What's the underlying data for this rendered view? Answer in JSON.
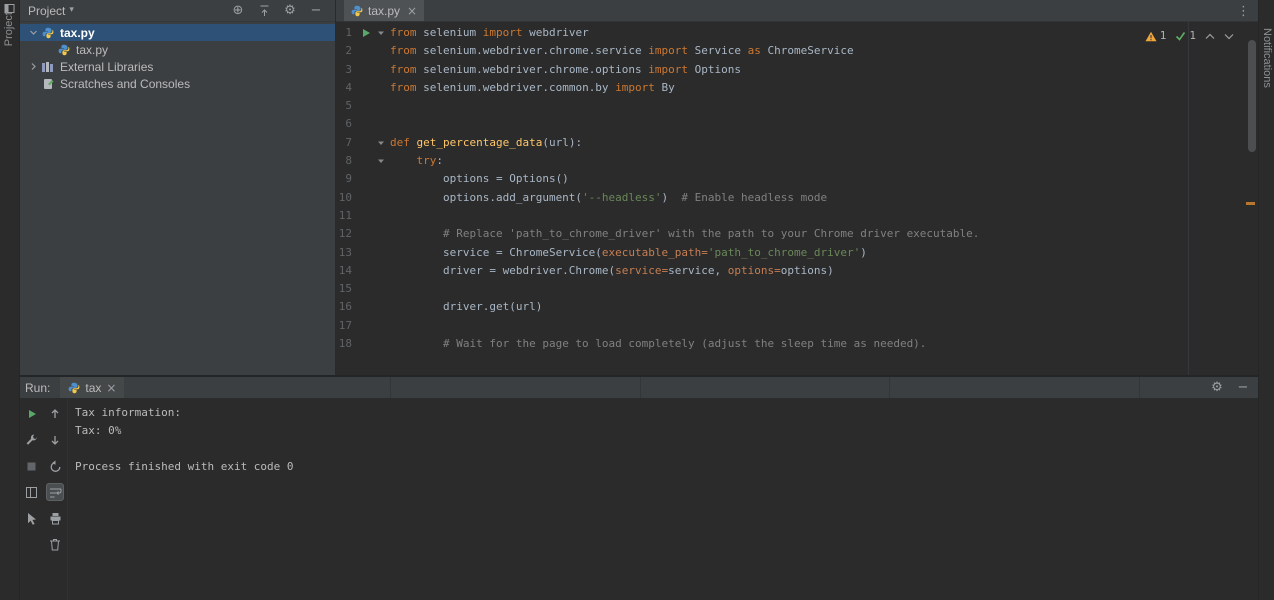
{
  "stripes": {
    "left_label": "Project",
    "right_label": "Notifications"
  },
  "glyphs": {
    "locate": "⊕",
    "gear": "⚙",
    "minus": "−",
    "dots": "⋮",
    "close": "×",
    "dropdown": "▾"
  },
  "colors": {
    "keyword": "#cc7832",
    "string": "#6a8759",
    "comment": "#808080",
    "function_name": "#ffc66b",
    "named_argument": "#c57e53",
    "selection": "#2d5177",
    "run_green": "#59a869",
    "warning": "#f0a63a",
    "ok_green": "#5fad65",
    "panel": "#3c3f41",
    "editor_bg": "#2b2b2b"
  },
  "project_panel": {
    "title": "Project",
    "header_icons": [
      {
        "name": "locate-file-icon",
        "icon": "locate"
      },
      {
        "name": "collapse-all-icon",
        "icon": "collapse"
      },
      {
        "name": "settings-gear-icon",
        "icon": "gear"
      },
      {
        "name": "hide-panel-icon",
        "icon": "minus"
      }
    ],
    "tree": [
      {
        "label": "tax.py",
        "icon": "python-file",
        "level": 0,
        "chevron": "down",
        "selected": true,
        "bold": true
      },
      {
        "label": "tax.py",
        "icon": "python-file",
        "level": 1
      },
      {
        "label": "External Libraries",
        "icon": "libraries",
        "level": 0,
        "chevron": "right"
      },
      {
        "label": "Scratches and Consoles",
        "icon": "scratches",
        "level": 0
      }
    ]
  },
  "editor": {
    "tab": {
      "label": "tax.py"
    },
    "inspections": {
      "warning_count": "1",
      "ok_count": "1"
    },
    "code": [
      {
        "n": "1",
        "run": true,
        "fold": true,
        "tokens": [
          [
            "from ",
            "kw"
          ],
          [
            "selenium ",
            "pl"
          ],
          [
            "import ",
            "kw"
          ],
          [
            "webdriver",
            "pl"
          ]
        ]
      },
      {
        "n": "2",
        "tokens": [
          [
            "from ",
            "kw"
          ],
          [
            "selenium.webdriver.chrome.service ",
            "pl"
          ],
          [
            "import ",
            "kw"
          ],
          [
            "Service ",
            "pl"
          ],
          [
            "as ",
            "kw"
          ],
          [
            "ChromeService",
            "pl"
          ]
        ]
      },
      {
        "n": "3",
        "tokens": [
          [
            "from ",
            "kw"
          ],
          [
            "selenium.webdriver.chrome.options ",
            "pl"
          ],
          [
            "import ",
            "kw"
          ],
          [
            "Options",
            "pl"
          ]
        ]
      },
      {
        "n": "4",
        "tokens": [
          [
            "from ",
            "kw"
          ],
          [
            "selenium.webdriver.common.by ",
            "pl"
          ],
          [
            "import ",
            "kw"
          ],
          [
            "By",
            "pl"
          ]
        ]
      },
      {
        "n": "5",
        "tokens": []
      },
      {
        "n": "6",
        "tokens": []
      },
      {
        "n": "7",
        "fold": true,
        "tokens": [
          [
            "def ",
            "kw"
          ],
          [
            "get_percentage_data",
            "fn"
          ],
          [
            "(url):",
            "pl"
          ]
        ]
      },
      {
        "n": "8",
        "fold": true,
        "tokens": [
          [
            "    ",
            "pl"
          ],
          [
            "try",
            "kw"
          ],
          [
            ":",
            "pl"
          ]
        ]
      },
      {
        "n": "9",
        "tokens": [
          [
            "        options = Options()",
            "pl"
          ]
        ]
      },
      {
        "n": "10",
        "tokens": [
          [
            "        options.add_argument(",
            "pl"
          ],
          [
            "'--headless'",
            "st"
          ],
          [
            ")  ",
            "pl"
          ],
          [
            "# Enable headless mode",
            "cm"
          ]
        ]
      },
      {
        "n": "11",
        "tokens": []
      },
      {
        "n": "12",
        "tokens": [
          [
            "        ",
            "pl"
          ],
          [
            "# Replace 'path_to_chrome_driver' with the path to your Chrome driver executable.",
            "cm"
          ]
        ]
      },
      {
        "n": "13",
        "tokens": [
          [
            "        service = ChromeService(",
            "pl"
          ],
          [
            "executable_path=",
            "ar"
          ],
          [
            "'path_to_chrome_driver'",
            "st"
          ],
          [
            ")",
            "pl"
          ]
        ]
      },
      {
        "n": "14",
        "tokens": [
          [
            "        driver = webdriver.Chrome(",
            "pl"
          ],
          [
            "service=",
            "ar"
          ],
          [
            "service, ",
            "pl"
          ],
          [
            "options=",
            "ar"
          ],
          [
            "options)",
            "pl"
          ]
        ]
      },
      {
        "n": "15",
        "tokens": []
      },
      {
        "n": "16",
        "tokens": [
          [
            "        driver.get(url)",
            "pl"
          ]
        ]
      },
      {
        "n": "17",
        "tokens": []
      },
      {
        "n": "18",
        "tokens": [
          [
            "        ",
            "pl"
          ],
          [
            "# Wait for the page to load completely (adjust the sleep time as needed).",
            "cm"
          ]
        ]
      }
    ]
  },
  "run_panel": {
    "label": "Run:",
    "tab": {
      "label": "tax"
    },
    "toolbar_a": [
      {
        "name": "rerun-button",
        "icon": "play"
      },
      {
        "name": "edit-configuration-wrench-icon",
        "icon": "wrench"
      },
      {
        "name": "stop-button",
        "icon": "stop"
      },
      {
        "name": "restore-layout-icon",
        "icon": "grid"
      },
      {
        "name": "inspect-pointer-icon",
        "icon": "pointer"
      }
    ],
    "toolbar_b": [
      {
        "name": "up-stack-trace-button",
        "icon": "up"
      },
      {
        "name": "down-stack-trace-button",
        "icon": "down"
      },
      {
        "name": "rerun-icon",
        "icon": "restart"
      },
      {
        "name": "soft-wrap-toggle",
        "icon": "softwrap",
        "selected": true
      },
      {
        "name": "print-icon",
        "icon": "print"
      },
      {
        "name": "clear-console-icon",
        "icon": "trash"
      }
    ],
    "header_icons": [
      {
        "name": "settings-gear-icon",
        "icon": "gear"
      },
      {
        "name": "hide-panel-icon",
        "icon": "minus"
      }
    ],
    "console_lines": [
      "Tax information:",
      "Tax: 0%",
      "",
      "Process finished with exit code 0"
    ]
  }
}
